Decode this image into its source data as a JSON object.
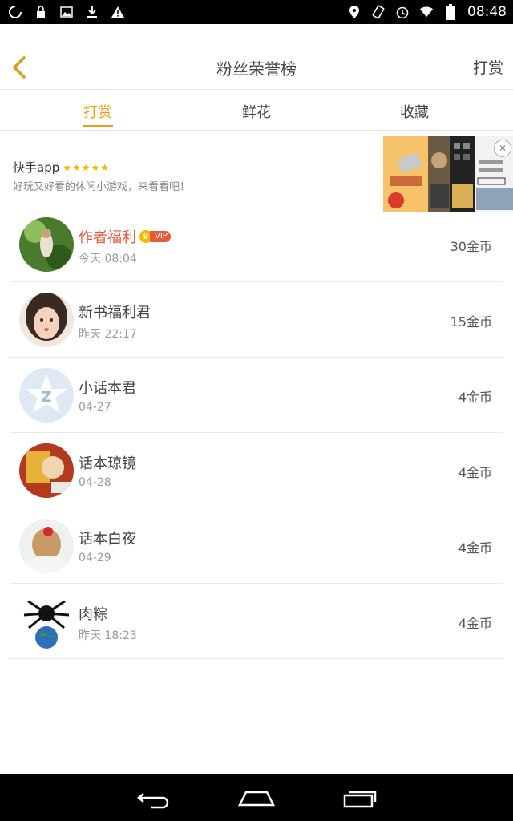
{
  "status_bar": {
    "time": "08:48",
    "left_icons": [
      "sync-icon",
      "lock-icon",
      "image-icon",
      "download-icon",
      "warning-icon"
    ],
    "right_icons": [
      "location-icon",
      "rotate-icon",
      "alarm-icon",
      "wifi-icon",
      "battery-icon"
    ]
  },
  "header": {
    "title": "粉丝荣誉榜",
    "right_action": "打赏",
    "back_icon": "chevron-left-icon",
    "accent_color": "#f39c12"
  },
  "tabs": [
    {
      "label": "打赏",
      "active": true
    },
    {
      "label": "鲜花",
      "active": false
    },
    {
      "label": "收藏",
      "active": false
    }
  ],
  "ad": {
    "title": "快手app",
    "stars": "★★★★★",
    "description": "好玩又好看的休闲小游戏，来看看吧！",
    "close_icon": "close-icon"
  },
  "list": [
    {
      "name": "作者福利",
      "time": "今天 08:04",
      "coins": "30金币",
      "vip": true,
      "vip_label": "VIP"
    },
    {
      "name": "新书福利君",
      "time": "昨天 22:17",
      "coins": "15金币",
      "vip": false
    },
    {
      "name": "小话本君",
      "time": "04-27",
      "coins": "4金币",
      "vip": false
    },
    {
      "name": "话本琼镜",
      "time": "04-28",
      "coins": "4金币",
      "vip": false
    },
    {
      "name": "话本白夜",
      "time": "04-29",
      "coins": "4金币",
      "vip": false
    },
    {
      "name": "肉粽",
      "time": "昨天 18:23",
      "coins": "4金币",
      "vip": false
    }
  ],
  "nav_bar": {
    "icons": [
      "back-nav-icon",
      "home-nav-icon",
      "recents-nav-icon"
    ]
  }
}
